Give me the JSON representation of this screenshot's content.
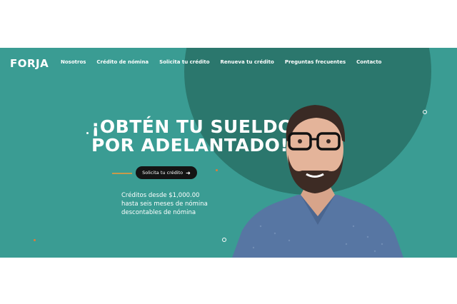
{
  "brand": {
    "logo_text": "FORJA"
  },
  "nav": {
    "items": [
      "Nosotros",
      "Crédito de nómina",
      "Solicita tu crédito",
      "Renueva tu crédito",
      "Preguntas frecuentes",
      "Contacto"
    ]
  },
  "hero": {
    "headline_line1": "¡OBTÉN TU SUELDO",
    "headline_line2": "POR ADELANTADO!",
    "cta_label": "Solicita tu crédito",
    "desc_line1": "Créditos desde $1,000.00",
    "desc_line2": "hasta seis meses de nómina",
    "desc_line3": "descontables de nómina"
  },
  "colors": {
    "teal": "#3a9c93",
    "teal_dark": "#2b776d",
    "accent_orange": "#e07a3a",
    "button": "#141414"
  }
}
